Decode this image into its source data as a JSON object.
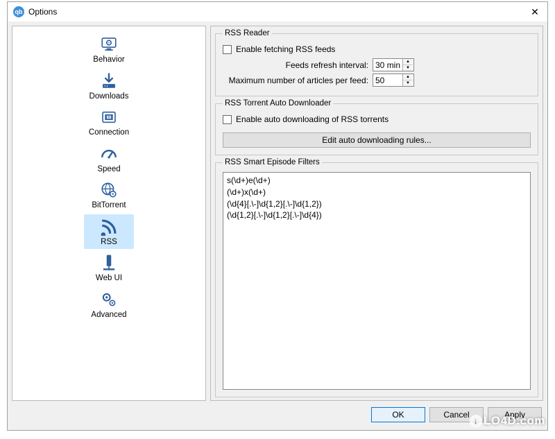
{
  "window": {
    "title": "Options"
  },
  "sidebar": {
    "items": [
      {
        "label": "Behavior"
      },
      {
        "label": "Downloads"
      },
      {
        "label": "Connection"
      },
      {
        "label": "Speed"
      },
      {
        "label": "BitTorrent"
      },
      {
        "label": "RSS"
      },
      {
        "label": "Web UI"
      },
      {
        "label": "Advanced"
      }
    ],
    "selected_index": 5
  },
  "rss_reader": {
    "group_title": "RSS Reader",
    "enable_label": "Enable fetching RSS feeds",
    "enable_checked": false,
    "interval_label": "Feeds refresh interval:",
    "interval_value": "30 min",
    "max_articles_label": "Maximum number of articles per feed:",
    "max_articles_value": "50"
  },
  "rss_auto": {
    "group_title": "RSS Torrent Auto Downloader",
    "enable_label": "Enable auto downloading of RSS torrents",
    "enable_checked": false,
    "edit_rules_label": "Edit auto downloading rules..."
  },
  "rss_filters": {
    "group_title": "RSS Smart Episode Filters",
    "text": "s(\\d+)e(\\d+)\n(\\d+)x(\\d+)\n(\\d{4}[.\\-]\\d{1,2}[.\\-]\\d{1,2})\n(\\d{1,2}[.\\-]\\d{1,2}[.\\-]\\d{4})"
  },
  "buttons": {
    "ok": "OK",
    "cancel": "Cancel",
    "apply": "Apply"
  },
  "watermark": "LO4D.com"
}
